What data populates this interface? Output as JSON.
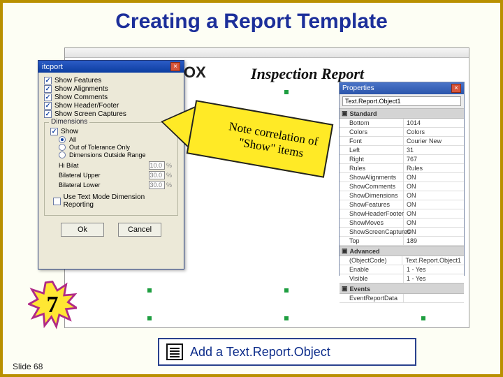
{
  "slide": {
    "title": "Creating a Report Template",
    "number_label": "Slide 68",
    "step_number": "7",
    "step_text": "Add a Text.Report.Object"
  },
  "canvas": {
    "brand_fragment": "OX",
    "doc_title": "Inspection Report"
  },
  "callout": {
    "text": "Note correlation of \"Show\" items"
  },
  "dialog": {
    "title": "itcport",
    "checkboxes": [
      {
        "label": "Show Features",
        "checked": true
      },
      {
        "label": "Show Alignments",
        "checked": true
      },
      {
        "label": "Show Comments",
        "checked": true
      },
      {
        "label": "Show Header/Footer",
        "checked": true
      },
      {
        "label": "Show Screen Captures",
        "checked": true
      }
    ],
    "group_title": "Dimensions",
    "show_checkbox": {
      "label": "Show",
      "checked": true
    },
    "radios": [
      {
        "label": "All",
        "selected": true
      },
      {
        "label": "Out of Tolerance Only",
        "selected": false
      },
      {
        "label": "Dimensions Outside Range",
        "selected": false
      }
    ],
    "num_fields": [
      {
        "label": "Hi Bilat",
        "value": "10.0"
      },
      {
        "label": "Bilateral Upper",
        "value": "30.0"
      },
      {
        "label": "Bilateral Lower",
        "value": "30.0"
      }
    ],
    "text_mode": {
      "label": "Use Text Mode Dimension Reporting",
      "checked": false
    },
    "ok_label": "Ok",
    "cancel_label": "Cancel"
  },
  "properties": {
    "title": "Properties",
    "object": "Text.Report.Object1",
    "groups": {
      "standard": "Standard",
      "advanced": "Advanced",
      "events": "Events"
    },
    "standard_rows": [
      {
        "k": "Bottom",
        "v": "1014"
      },
      {
        "k": "Colors",
        "v": "Colors"
      },
      {
        "k": "Font",
        "v": "Courier New"
      },
      {
        "k": "Left",
        "v": "31"
      },
      {
        "k": "Right",
        "v": "767"
      },
      {
        "k": "Rules",
        "v": "Rules"
      },
      {
        "k": "ShowAlignments",
        "v": "ON"
      },
      {
        "k": "ShowComments",
        "v": "ON"
      },
      {
        "k": "ShowDimensions",
        "v": "ON"
      },
      {
        "k": "ShowFeatures",
        "v": "ON"
      },
      {
        "k": "ShowHeaderFooter",
        "v": "ON"
      },
      {
        "k": "ShowMoves",
        "v": "ON"
      },
      {
        "k": "ShowScreenCaptures",
        "v": "ON"
      },
      {
        "k": "Top",
        "v": "189"
      }
    ],
    "advanced_rows": [
      {
        "k": "(ObjectCode)",
        "v": "Text.Report.Object1"
      },
      {
        "k": "Enable",
        "v": "1 - Yes"
      },
      {
        "k": "Visible",
        "v": "1 - Yes"
      }
    ],
    "events_rows": [
      {
        "k": "EventReportData",
        "v": ""
      }
    ]
  }
}
